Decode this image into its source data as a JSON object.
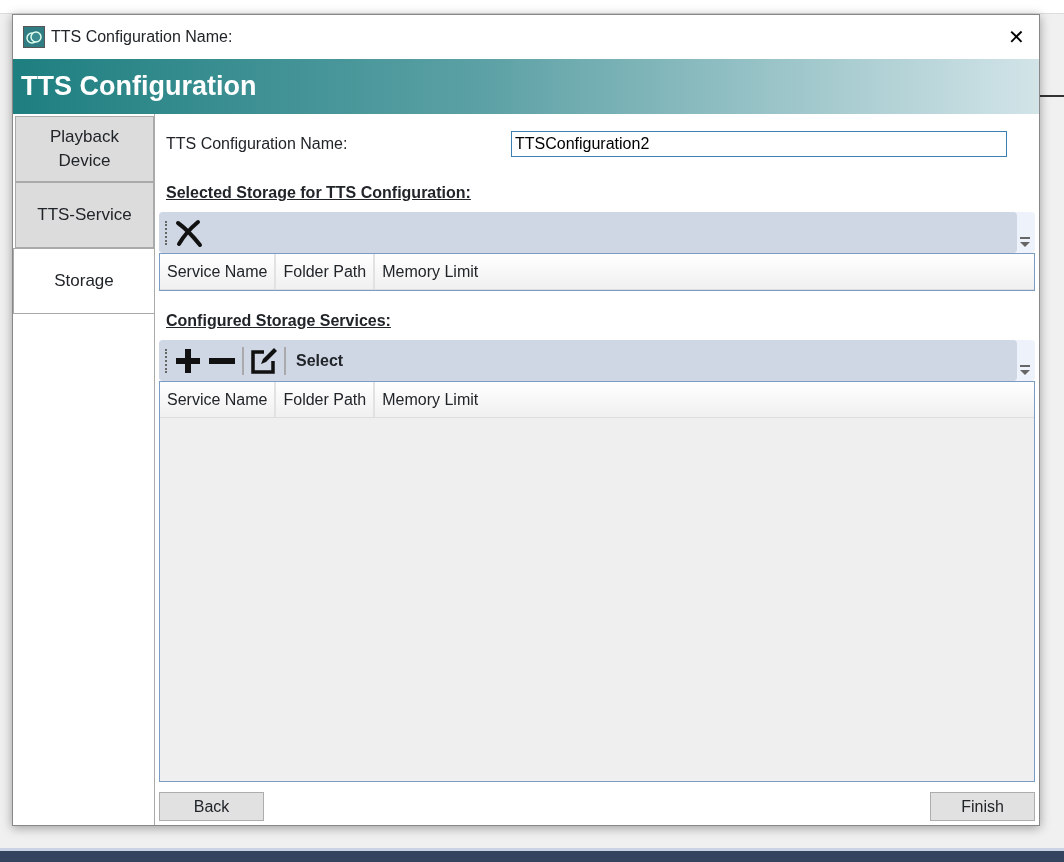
{
  "window": {
    "title": "TTS Configuration Name:",
    "close": "✕"
  },
  "header": {
    "title": "TTS Configuration"
  },
  "nav": [
    {
      "label": "Playback Device",
      "selected": false
    },
    {
      "label": "TTS-Service",
      "selected": false
    },
    {
      "label": "Storage",
      "selected": true
    }
  ],
  "name_field": {
    "label": "TTS Configuration Name:",
    "value": "TTSConfiguration2"
  },
  "sections": [
    {
      "heading": "Selected Storage for TTS Configuration:",
      "tools": [
        {
          "kind": "remove"
        }
      ],
      "columns": [
        "Service Name",
        "Folder Path",
        "Memory Limit"
      ]
    },
    {
      "heading": "Configured Storage Services:",
      "tools": [
        {
          "kind": "add"
        },
        {
          "kind": "delete"
        },
        {
          "kind": "sep"
        },
        {
          "kind": "edit"
        },
        {
          "kind": "sep"
        },
        {
          "kind": "text",
          "label": "Select"
        }
      ],
      "columns": [
        "Service Name",
        "Folder Path",
        "Memory Limit"
      ]
    }
  ],
  "buttons": {
    "back": "Back",
    "finish": "Finish"
  }
}
